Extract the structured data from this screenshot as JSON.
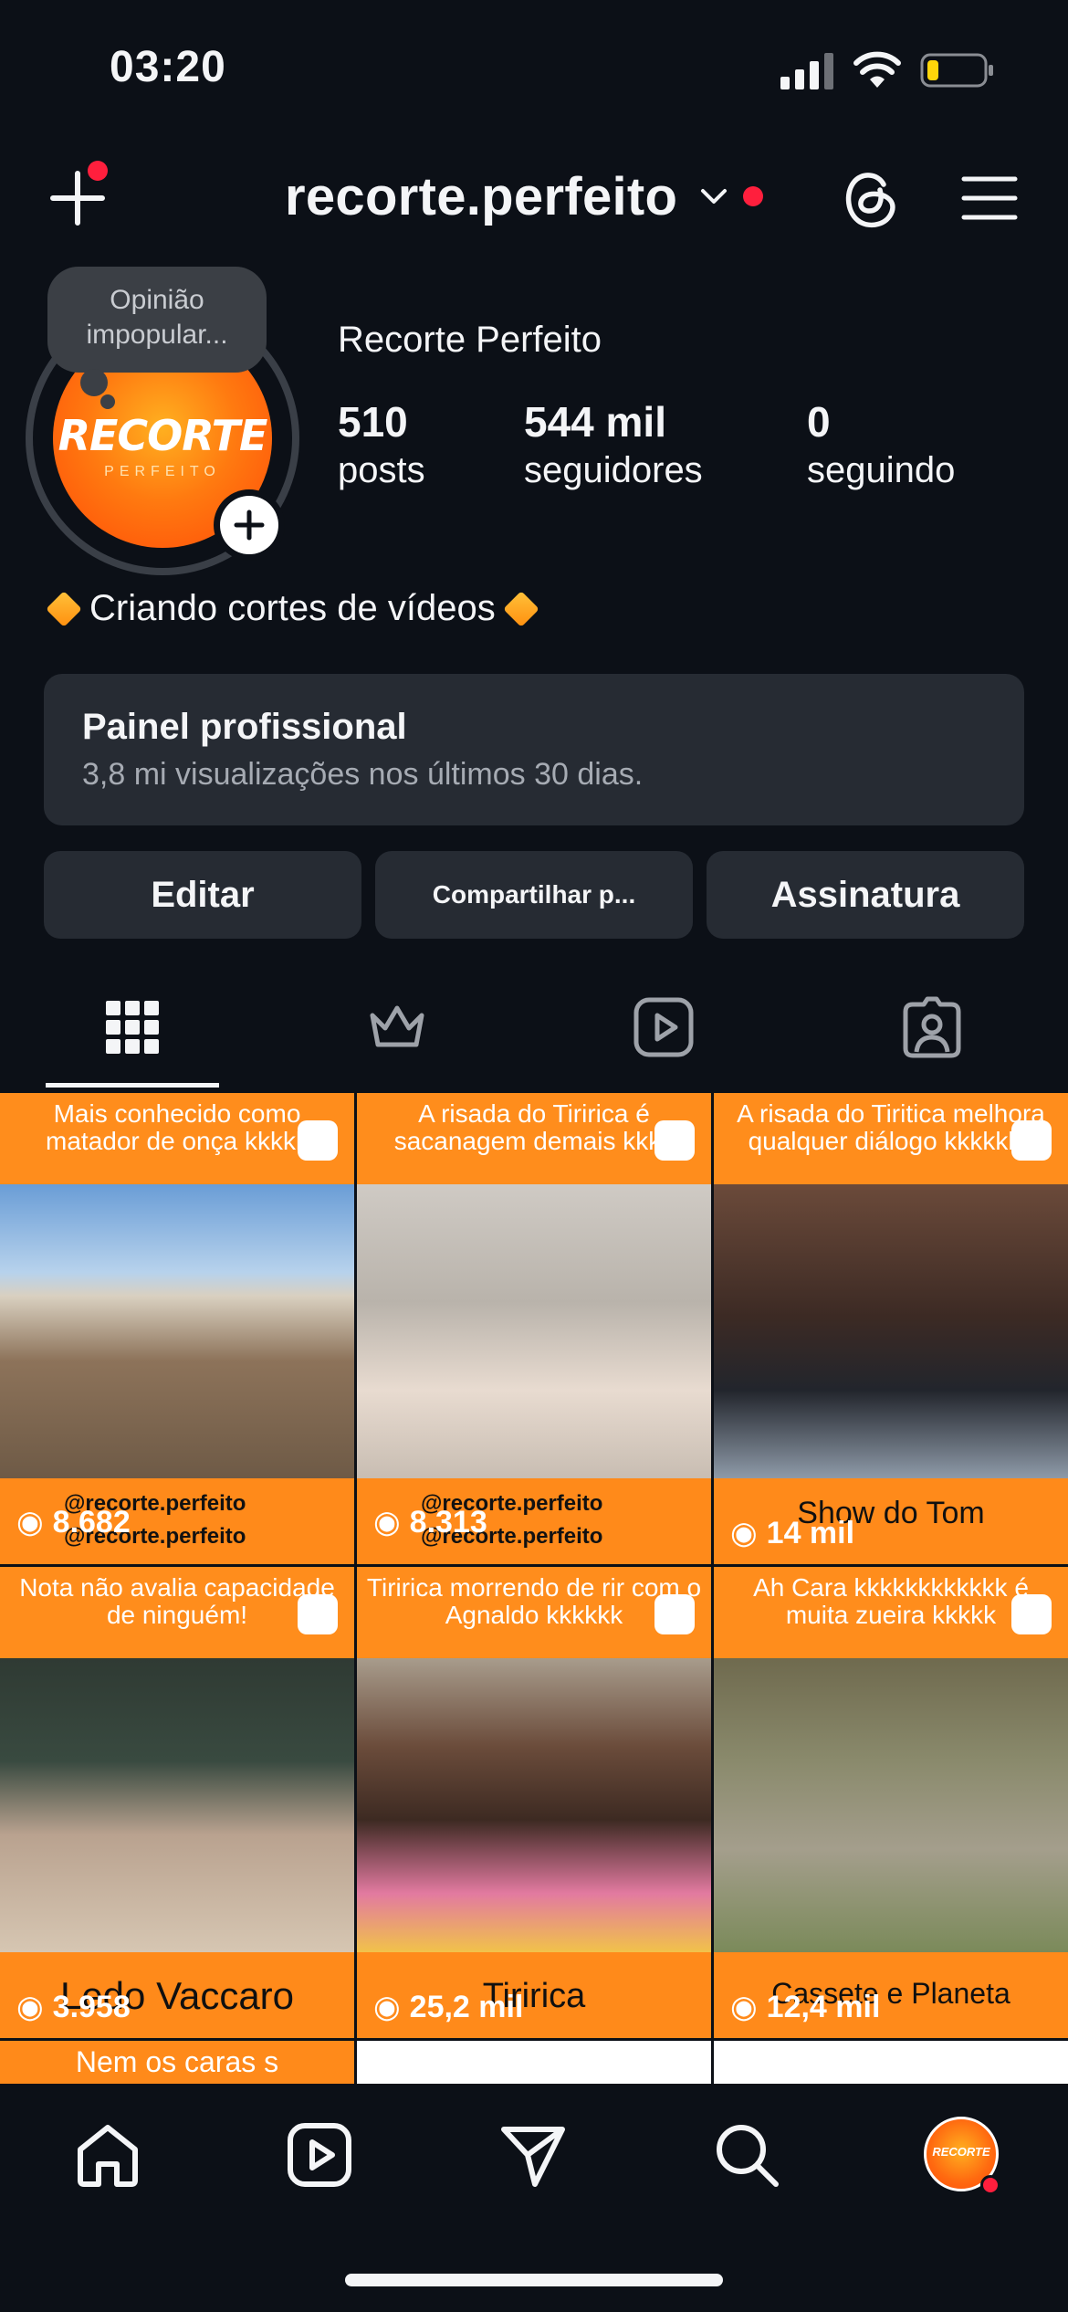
{
  "status_bar": {
    "time": "03:20"
  },
  "header": {
    "username": "recorte.perfeito"
  },
  "profile": {
    "note": "Opinião impopular...",
    "avatar_logo": "RECORTE",
    "avatar_logo_sub": "PERFEITO",
    "display_name": "Recorte Perfeito",
    "stats": [
      {
        "num": "510",
        "label": "posts"
      },
      {
        "num": "544 mil",
        "label": "seguidores"
      },
      {
        "num": "0",
        "label": "seguindo"
      }
    ],
    "bio": "Criando cortes de vídeos"
  },
  "dashboard": {
    "title": "Painel profissional",
    "subtitle": "3,8 mi visualizações nos últimos 30 dias."
  },
  "actions": {
    "edit": "Editar",
    "share": "Compartilhar p...",
    "subscription": "Assinatura"
  },
  "tabs": [
    "grid-icon",
    "crown-icon",
    "reels-icon",
    "tagged-icon"
  ],
  "posts": [
    {
      "caption": "Mais conhecido como matador de onça kkkkk",
      "label": "",
      "views": "8.682",
      "handle1": "@recorte.perfeito",
      "handle2": "@recorte.perfeito",
      "photo": "#7b6a56"
    },
    {
      "caption": "A risada do Tiririca é sacanagem demais kkkk",
      "label": "",
      "views": "8.313",
      "handle1": "@recorte.perfeito",
      "handle2": "@recorte.perfeito",
      "photo": "#c9c2bb"
    },
    {
      "caption": "A risada do Tiritica melhora qualquer diálogo kkkkkkk",
      "label": "Show do Tom",
      "views": "14 mil",
      "handle1": "",
      "handle2": "",
      "photo": "#5b3b2e"
    },
    {
      "caption": "Nota não avalia capacidade de ninguém!",
      "label": "Ledo Vaccaro",
      "views": "3.958",
      "handle1": "",
      "handle2": "",
      "photo": "#3f4b44"
    },
    {
      "caption": "Tiririca morrendo de rir com o Agnaldo kkkkkk",
      "label": "Tiririca",
      "views": "25,2 mil",
      "handle1": "",
      "handle2": "",
      "photo": "#8c6a5a"
    },
    {
      "caption": "Ah Cara kkkkkkkkkkkk é muita zueira kkkkk",
      "label": "Cassete e Planeta",
      "views": "12,4 mil",
      "handle1": "",
      "handle2": "",
      "photo": "#7c7a62"
    }
  ],
  "partial_row_caption": "Nem os caras s",
  "nav": [
    "home-icon",
    "reels-icon",
    "send-icon",
    "search-icon",
    "profile-avatar"
  ],
  "colors": {
    "background": "#0c1017",
    "card": "#262b33",
    "accent_orange": "#ff8a1a",
    "notification_red": "#ff1f3d"
  }
}
